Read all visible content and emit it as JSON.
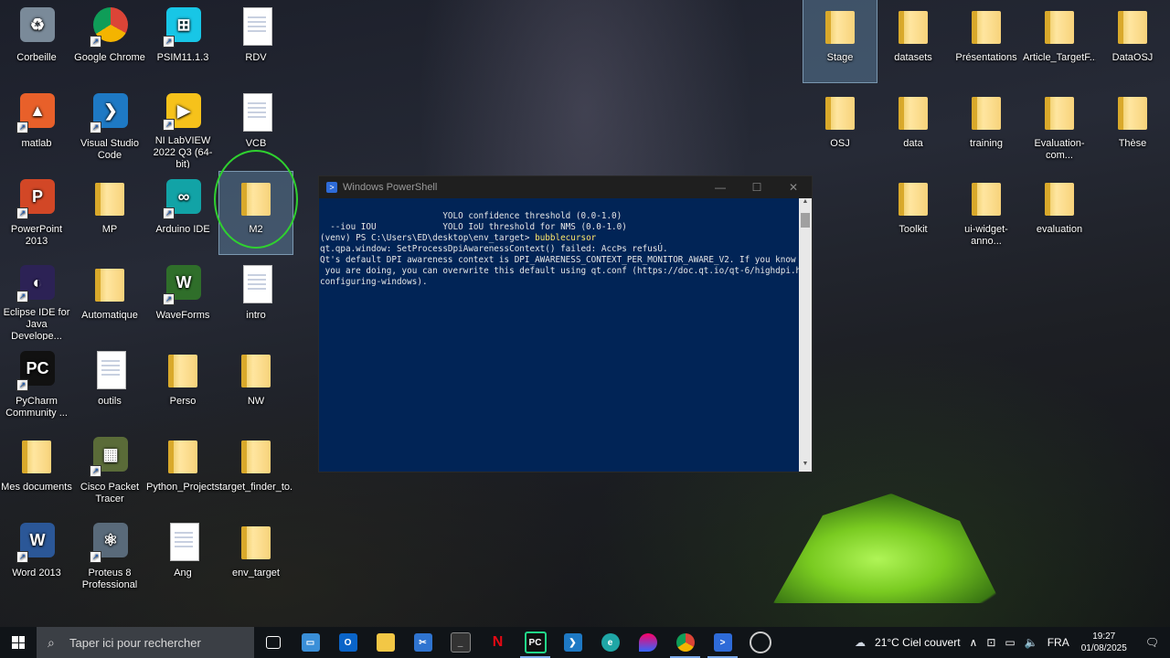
{
  "desktop_icons": [
    {
      "label": "Corbeille",
      "type": "recycle"
    },
    {
      "label": "Google Chrome",
      "type": "chrome"
    },
    {
      "label": "PSIM11.1.3",
      "type": "psim"
    },
    {
      "label": "RDV",
      "type": "word-doc"
    },
    {
      "label": "matlab",
      "type": "matlab"
    },
    {
      "label": "Visual Studio Code",
      "type": "vscode"
    },
    {
      "label": "NI LabVIEW 2022 Q3 (64-bit)",
      "type": "labview"
    },
    {
      "label": "VCB",
      "type": "doc"
    },
    {
      "label": "PowerPoint 2013",
      "type": "powerpoint"
    },
    {
      "label": "MP",
      "type": "folder"
    },
    {
      "label": "Arduino IDE",
      "type": "arduino"
    },
    {
      "label": "M2",
      "type": "folder"
    },
    {
      "label": "Eclipse IDE for Java Develope...",
      "type": "eclipse"
    },
    {
      "label": "Automatique",
      "type": "folder"
    },
    {
      "label": "WaveForms",
      "type": "waveforms"
    },
    {
      "label": "intro",
      "type": "word-doc"
    },
    {
      "label": "PyCharm Community ...",
      "type": "pycharm"
    },
    {
      "label": "outils",
      "type": "doc"
    },
    {
      "label": "Perso",
      "type": "folder"
    },
    {
      "label": "NW",
      "type": "folder"
    },
    {
      "label": "Mes documents",
      "type": "folder"
    },
    {
      "label": "Cisco Packet Tracer",
      "type": "cisco"
    },
    {
      "label": "Python_Projects...",
      "type": "folder"
    },
    {
      "label": "target_finder_to...",
      "type": "folder"
    },
    {
      "label": "Word 2013",
      "type": "word"
    },
    {
      "label": "Proteus 8 Professional",
      "type": "proteus"
    },
    {
      "label": "Ang",
      "type": "doc"
    },
    {
      "label": "env_target",
      "type": "folder"
    },
    {
      "label": "Stage",
      "type": "folder"
    },
    {
      "label": "datasets",
      "type": "folder"
    },
    {
      "label": "Présentations",
      "type": "folder"
    },
    {
      "label": "Article_TargetF...",
      "type": "folder"
    },
    {
      "label": "DataOSJ",
      "type": "folder"
    },
    {
      "label": "OSJ",
      "type": "folder"
    },
    {
      "label": "data",
      "type": "folder"
    },
    {
      "label": "training",
      "type": "folder"
    },
    {
      "label": "Evaluation-com...",
      "type": "folder"
    },
    {
      "label": "Thèse",
      "type": "folder"
    },
    {
      "label": "Toolkit",
      "type": "folder"
    },
    {
      "label": "ui-widget-anno...",
      "type": "folder"
    },
    {
      "label": "evaluation",
      "type": "folder"
    }
  ],
  "powershell": {
    "title": "Windows PowerShell",
    "lines": [
      "                        YOLO confidence threshold (0.0-1.0)",
      "  --iou IOU             YOLO IoU threshold for NMS (0.0-1.0)",
      "(venv) PS C:\\Users\\ED\\desktop\\env_target> bubblecursor",
      "qt.qpa.window: SetProcessDpiAwarenessContext() failed: AccÞs refusÚ.",
      "Qt's default DPI awareness context is DPI_AWARENESS_CONTEXT_PER_MONITOR_AWARE_V2. If you know what",
      " you are doing, you can overwrite this default using qt.conf (https://doc.qt.io/qt-6/highdpi.html#",
      "configuring-windows)."
    ],
    "prompt": "(venv) PS C:\\Users\\ED\\desktop\\env_target> ",
    "command": "bubblecursor"
  },
  "taskbar": {
    "search_placeholder": "Taper ici pour rechercher",
    "weather": "21°C  Ciel couvert",
    "language": "FRA",
    "time": "19:27",
    "date": "01/08/2025"
  }
}
